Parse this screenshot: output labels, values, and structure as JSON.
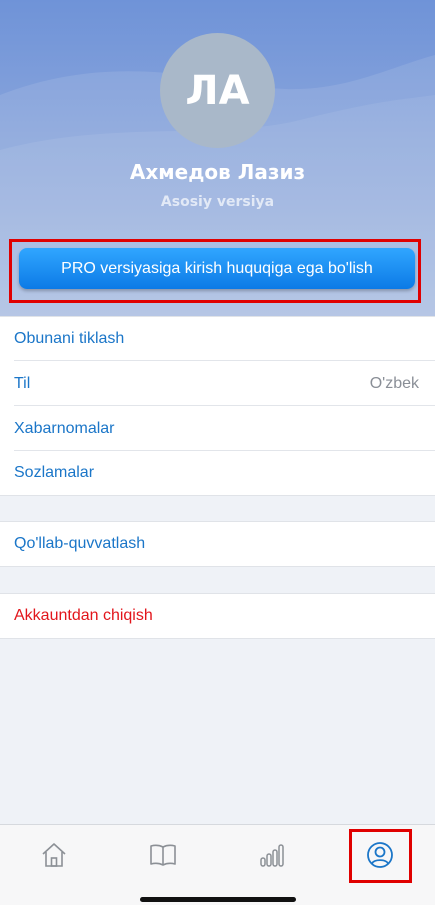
{
  "profile": {
    "initials": "ЛА",
    "name": "Ахмедов Лазиз",
    "plan": "Asosiy versiya",
    "pro_button": "PRO versiyasiga kirish huquqiga ega bo'lish"
  },
  "menu_group_1": [
    {
      "label": "Obunani tiklash"
    },
    {
      "label": "Til",
      "value": "O'zbek"
    },
    {
      "label": "Xabarnomalar"
    },
    {
      "label": "Sozlamalar"
    }
  ],
  "menu_group_2": [
    {
      "label": "Qo'llab-quvvatlash"
    }
  ],
  "menu_group_3": [
    {
      "label": "Akkauntdan chiqish"
    }
  ],
  "tabbar": {
    "tabs": [
      {
        "icon": "home-icon",
        "active": false
      },
      {
        "icon": "book-icon",
        "active": false
      },
      {
        "icon": "bar-chart-icon",
        "active": false
      },
      {
        "icon": "profile-icon",
        "active": true
      }
    ]
  },
  "colors": {
    "accent": "#1b76c8",
    "danger": "#e2151b",
    "highlight": "#e00000",
    "header": "#7d9bd9"
  }
}
